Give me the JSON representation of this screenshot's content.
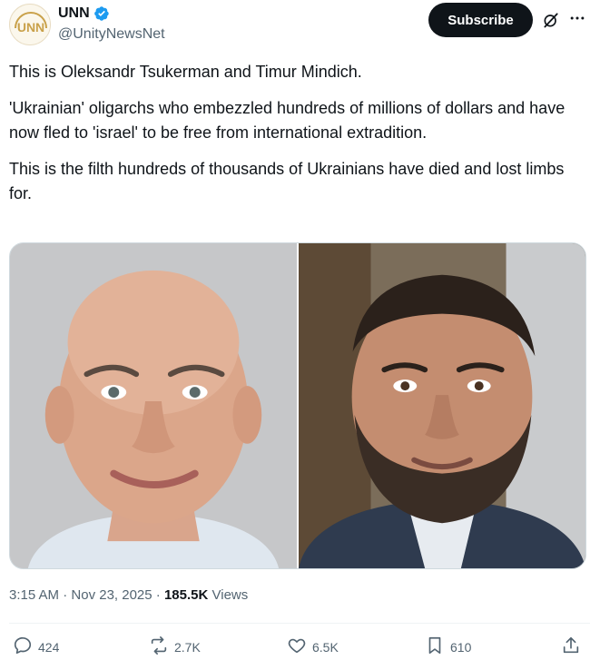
{
  "account": {
    "avatar_text": "UNN",
    "display_name": "UNN",
    "handle": "@UnityNewsNet",
    "verified": true
  },
  "header": {
    "subscribe_label": "Subscribe"
  },
  "tweet": {
    "paragraphs": [
      "This is Oleksandr Tsukerman and Timur Mindich.",
      "'Ukrainian' oligarchs who embezzled hundreds of millions of dollars and have now fled to 'israel' to be free from international extradition.",
      "This is the filth hundreds of thousands of Ukrainians have died and lost limbs for."
    ],
    "time": "3:15 AM",
    "separator": "·",
    "date": "Nov 23, 2025",
    "views_count": "185.5K",
    "views_label": "Views"
  },
  "stats": {
    "replies": "424",
    "reposts": "2.7K",
    "likes": "6.5K",
    "bookmarks": "610"
  },
  "icons": {
    "verified": "verified-badge-icon",
    "grok": "grok-icon",
    "more": "more-options-icon",
    "reply": "reply-icon",
    "repost": "repost-icon",
    "like": "like-icon",
    "bookmark": "bookmark-icon",
    "share": "share-icon"
  },
  "colors": {
    "text_primary": "#0f1419",
    "text_secondary": "#536471",
    "verified_blue": "#1d9bf0",
    "subscribe_bg": "#0f1419",
    "avatar_gold": "#c9a14a"
  }
}
